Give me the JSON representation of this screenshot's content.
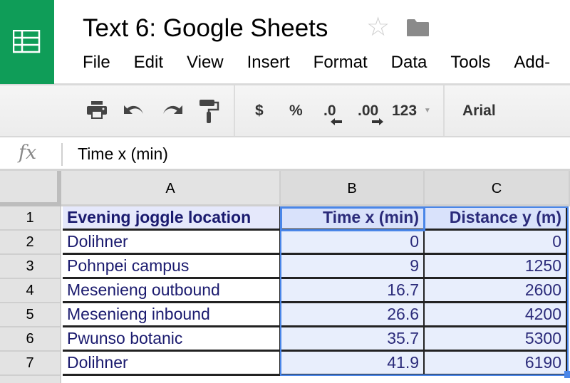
{
  "app": {
    "title": "Text 6: Google Sheets",
    "logo_icon": "sheets-logo-icon",
    "star_icon": "star-icon",
    "folder_icon": "folder-icon",
    "brand_color": "#0f9d58"
  },
  "menu": [
    "File",
    "Edit",
    "View",
    "Insert",
    "Format",
    "Data",
    "Tools",
    "Add-"
  ],
  "toolbar": {
    "icons": [
      "print-icon",
      "undo-icon",
      "redo-icon",
      "paint-format-icon"
    ],
    "currency": "$",
    "percent": "%",
    "decrease_decimal": ".0",
    "increase_decimal": ".00",
    "more_formats": "123",
    "font": "Arial"
  },
  "formula_bar": {
    "fx_label": "fx",
    "value": "Time x (min)"
  },
  "grid": {
    "columns": [
      "A",
      "B",
      "C"
    ],
    "row_numbers": [
      "1",
      "2",
      "3",
      "4",
      "5",
      "6",
      "7"
    ],
    "header_row": [
      "Evening joggle location",
      "Time x (min)",
      "Distance y (m)"
    ],
    "rows": [
      [
        "Dolihner",
        "0",
        "0"
      ],
      [
        "Pohnpei campus",
        "9",
        "1250"
      ],
      [
        "Mesenieng outbound",
        "16.7",
        "2600"
      ],
      [
        "Mesenieng inbound",
        "26.6",
        "4200"
      ],
      [
        "Pwunso botanic",
        "35.7",
        "5300"
      ],
      [
        "Dolihner",
        "41.9",
        "6190"
      ]
    ],
    "active_cell": "B1",
    "selected_range": "B1:C7",
    "selection_color": "#4a86e8"
  }
}
